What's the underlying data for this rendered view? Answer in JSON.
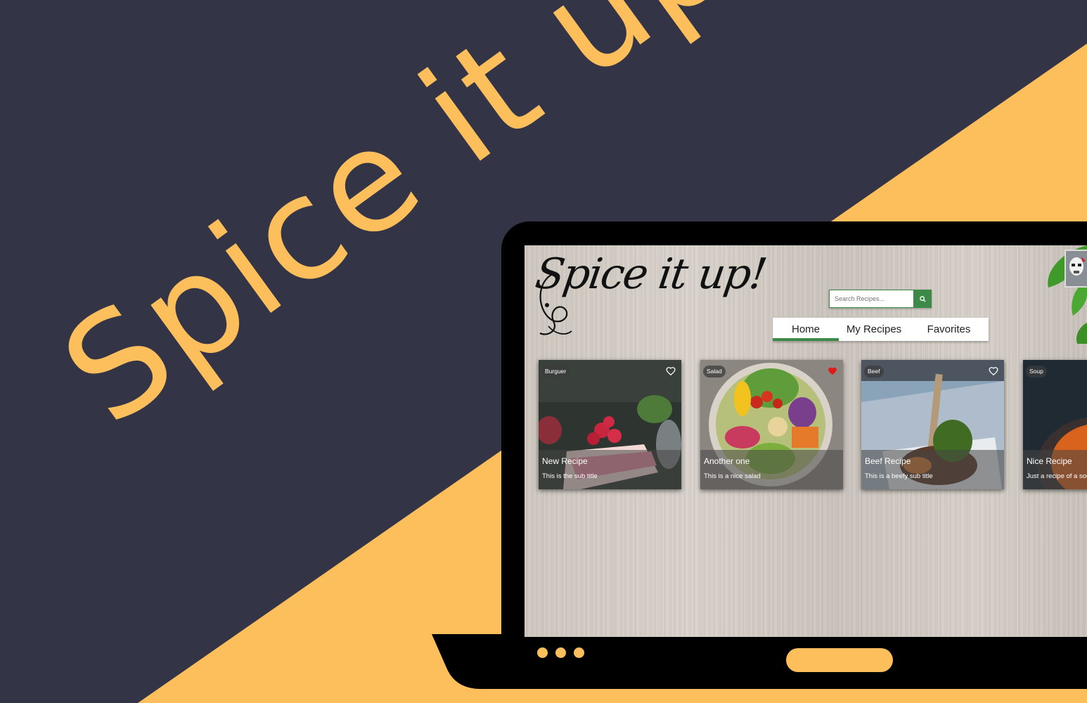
{
  "promo": {
    "headline": "Spice it up!",
    "colors": {
      "background": "#333547",
      "accent": "#fdbf5c",
      "laptop": "#000000"
    }
  },
  "app": {
    "logo_text": "Spice it up!",
    "search": {
      "placeholder": "Search Recipes...",
      "button_icon": "search-icon"
    },
    "nav": [
      {
        "label": "Home",
        "active": true
      },
      {
        "label": "My Recipes",
        "active": false
      },
      {
        "label": "Favorites",
        "active": false
      }
    ],
    "accent_color": "#3d8a48",
    "cards": [
      {
        "category": "Burguer",
        "title": "New Recipe",
        "subtitle": "This is the sub title",
        "favorite": false,
        "image": "raspberry-cake"
      },
      {
        "category": "Salad",
        "title": "Another one",
        "subtitle": "This is a nice salad",
        "favorite": true,
        "image": "salad-bowl"
      },
      {
        "category": "Beef",
        "title": "Beef Recipe",
        "subtitle": "This is a beefy sub title",
        "favorite": false,
        "image": "beef-steak"
      },
      {
        "category": "Soup",
        "title": "Nice Recipe",
        "subtitle": "Just a recipe of a soup",
        "favorite": false,
        "image": "soup-bowl"
      }
    ]
  }
}
